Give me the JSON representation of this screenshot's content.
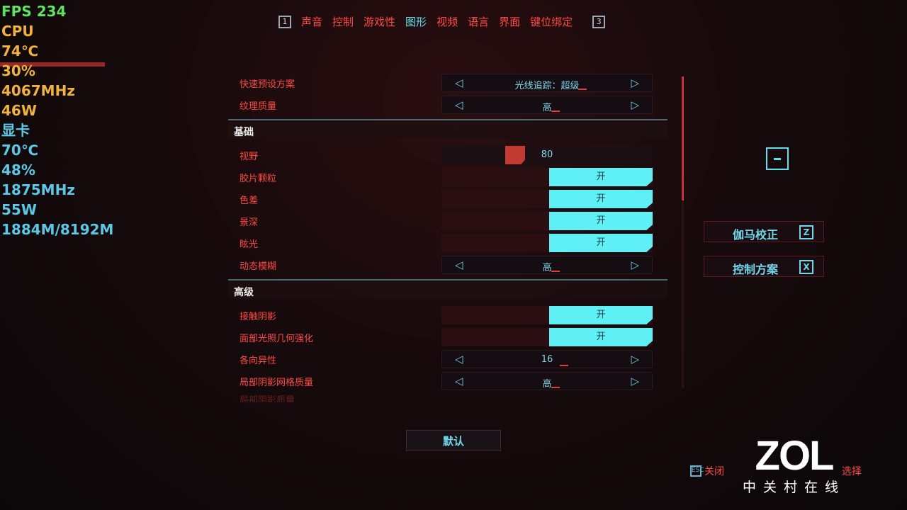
{
  "osd": {
    "fps": "FPS  234",
    "cpu_label": "CPU",
    "cpu_temp": "74℃",
    "cpu_load": "30%",
    "cpu_clock": "4067MHz",
    "cpu_power": "46W",
    "gpu_label": "显卡",
    "gpu_temp": "70℃",
    "gpu_load": "48%",
    "gpu_clock": "1875MHz",
    "gpu_power": "55W",
    "gpu_mem": "1884M/8192M"
  },
  "tabs": {
    "prev_key": "1",
    "next_key": "3",
    "items": [
      "声音",
      "控制",
      "游戏性",
      "图形",
      "视频",
      "语言",
      "界面",
      "键位绑定"
    ],
    "active": "图形"
  },
  "settings": {
    "preset": {
      "label": "快速预设方案",
      "value": "光线追踪：超级"
    },
    "texture": {
      "label": "纹理质量",
      "value": "高"
    },
    "basic_title": "基础",
    "fov": {
      "label": "视野",
      "value": "80"
    },
    "film_grain": {
      "label": "胶片颗粒",
      "value": "开"
    },
    "chromatic": {
      "label": "色差",
      "value": "开"
    },
    "dof": {
      "label": "景深",
      "value": "开"
    },
    "lens_flare": {
      "label": "眩光",
      "value": "开"
    },
    "motion_blur": {
      "label": "动态模糊",
      "value": "高"
    },
    "advanced_title": "高级",
    "contact_shadows": {
      "label": "接触阴影",
      "value": "开"
    },
    "face_lighting": {
      "label": "面部光照几何强化",
      "value": "开"
    },
    "anisotropy": {
      "label": "各向异性",
      "value": "16"
    },
    "local_shadow_mesh": {
      "label": "局部阴影网格质量",
      "value": "高"
    },
    "local_shadow_quality": {
      "label": "局部阴影质量"
    }
  },
  "default_button": "默认",
  "side": {
    "gamma": "伽马校正",
    "gamma_key": "Z",
    "controls": "控制方案",
    "controls_key": "X"
  },
  "hints": {
    "close": "关闭",
    "close_key": "ESC",
    "select": "选择"
  },
  "watermark": {
    "brand": "ZOL",
    "sub": "中关村在线"
  },
  "colors": {
    "accent_red": "#ff4a44",
    "accent_cyan": "#5ff0f6"
  }
}
